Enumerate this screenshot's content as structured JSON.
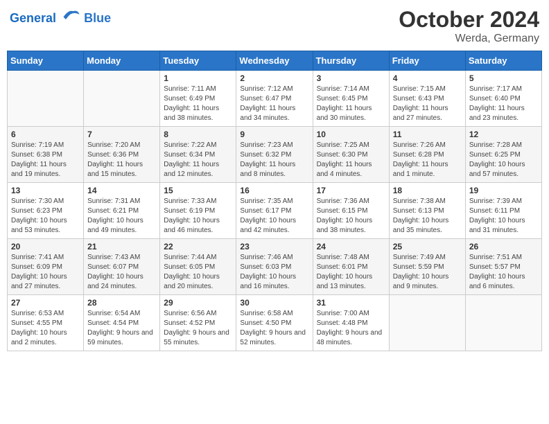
{
  "header": {
    "logo_text_general": "General",
    "logo_text_blue": "Blue",
    "month_title": "October 2024",
    "location": "Werda, Germany"
  },
  "calendar": {
    "days_of_week": [
      "Sunday",
      "Monday",
      "Tuesday",
      "Wednesday",
      "Thursday",
      "Friday",
      "Saturday"
    ],
    "weeks": [
      [
        {
          "day": "",
          "detail": ""
        },
        {
          "day": "",
          "detail": ""
        },
        {
          "day": "1",
          "detail": "Sunrise: 7:11 AM\nSunset: 6:49 PM\nDaylight: 11 hours and 38 minutes."
        },
        {
          "day": "2",
          "detail": "Sunrise: 7:12 AM\nSunset: 6:47 PM\nDaylight: 11 hours and 34 minutes."
        },
        {
          "day": "3",
          "detail": "Sunrise: 7:14 AM\nSunset: 6:45 PM\nDaylight: 11 hours and 30 minutes."
        },
        {
          "day": "4",
          "detail": "Sunrise: 7:15 AM\nSunset: 6:43 PM\nDaylight: 11 hours and 27 minutes."
        },
        {
          "day": "5",
          "detail": "Sunrise: 7:17 AM\nSunset: 6:40 PM\nDaylight: 11 hours and 23 minutes."
        }
      ],
      [
        {
          "day": "6",
          "detail": "Sunrise: 7:19 AM\nSunset: 6:38 PM\nDaylight: 11 hours and 19 minutes."
        },
        {
          "day": "7",
          "detail": "Sunrise: 7:20 AM\nSunset: 6:36 PM\nDaylight: 11 hours and 15 minutes."
        },
        {
          "day": "8",
          "detail": "Sunrise: 7:22 AM\nSunset: 6:34 PM\nDaylight: 11 hours and 12 minutes."
        },
        {
          "day": "9",
          "detail": "Sunrise: 7:23 AM\nSunset: 6:32 PM\nDaylight: 11 hours and 8 minutes."
        },
        {
          "day": "10",
          "detail": "Sunrise: 7:25 AM\nSunset: 6:30 PM\nDaylight: 11 hours and 4 minutes."
        },
        {
          "day": "11",
          "detail": "Sunrise: 7:26 AM\nSunset: 6:28 PM\nDaylight: 11 hours and 1 minute."
        },
        {
          "day": "12",
          "detail": "Sunrise: 7:28 AM\nSunset: 6:25 PM\nDaylight: 10 hours and 57 minutes."
        }
      ],
      [
        {
          "day": "13",
          "detail": "Sunrise: 7:30 AM\nSunset: 6:23 PM\nDaylight: 10 hours and 53 minutes."
        },
        {
          "day": "14",
          "detail": "Sunrise: 7:31 AM\nSunset: 6:21 PM\nDaylight: 10 hours and 49 minutes."
        },
        {
          "day": "15",
          "detail": "Sunrise: 7:33 AM\nSunset: 6:19 PM\nDaylight: 10 hours and 46 minutes."
        },
        {
          "day": "16",
          "detail": "Sunrise: 7:35 AM\nSunset: 6:17 PM\nDaylight: 10 hours and 42 minutes."
        },
        {
          "day": "17",
          "detail": "Sunrise: 7:36 AM\nSunset: 6:15 PM\nDaylight: 10 hours and 38 minutes."
        },
        {
          "day": "18",
          "detail": "Sunrise: 7:38 AM\nSunset: 6:13 PM\nDaylight: 10 hours and 35 minutes."
        },
        {
          "day": "19",
          "detail": "Sunrise: 7:39 AM\nSunset: 6:11 PM\nDaylight: 10 hours and 31 minutes."
        }
      ],
      [
        {
          "day": "20",
          "detail": "Sunrise: 7:41 AM\nSunset: 6:09 PM\nDaylight: 10 hours and 27 minutes."
        },
        {
          "day": "21",
          "detail": "Sunrise: 7:43 AM\nSunset: 6:07 PM\nDaylight: 10 hours and 24 minutes."
        },
        {
          "day": "22",
          "detail": "Sunrise: 7:44 AM\nSunset: 6:05 PM\nDaylight: 10 hours and 20 minutes."
        },
        {
          "day": "23",
          "detail": "Sunrise: 7:46 AM\nSunset: 6:03 PM\nDaylight: 10 hours and 16 minutes."
        },
        {
          "day": "24",
          "detail": "Sunrise: 7:48 AM\nSunset: 6:01 PM\nDaylight: 10 hours and 13 minutes."
        },
        {
          "day": "25",
          "detail": "Sunrise: 7:49 AM\nSunset: 5:59 PM\nDaylight: 10 hours and 9 minutes."
        },
        {
          "day": "26",
          "detail": "Sunrise: 7:51 AM\nSunset: 5:57 PM\nDaylight: 10 hours and 6 minutes."
        }
      ],
      [
        {
          "day": "27",
          "detail": "Sunrise: 6:53 AM\nSunset: 4:55 PM\nDaylight: 10 hours and 2 minutes."
        },
        {
          "day": "28",
          "detail": "Sunrise: 6:54 AM\nSunset: 4:54 PM\nDaylight: 9 hours and 59 minutes."
        },
        {
          "day": "29",
          "detail": "Sunrise: 6:56 AM\nSunset: 4:52 PM\nDaylight: 9 hours and 55 minutes."
        },
        {
          "day": "30",
          "detail": "Sunrise: 6:58 AM\nSunset: 4:50 PM\nDaylight: 9 hours and 52 minutes."
        },
        {
          "day": "31",
          "detail": "Sunrise: 7:00 AM\nSunset: 4:48 PM\nDaylight: 9 hours and 48 minutes."
        },
        {
          "day": "",
          "detail": ""
        },
        {
          "day": "",
          "detail": ""
        }
      ]
    ]
  }
}
